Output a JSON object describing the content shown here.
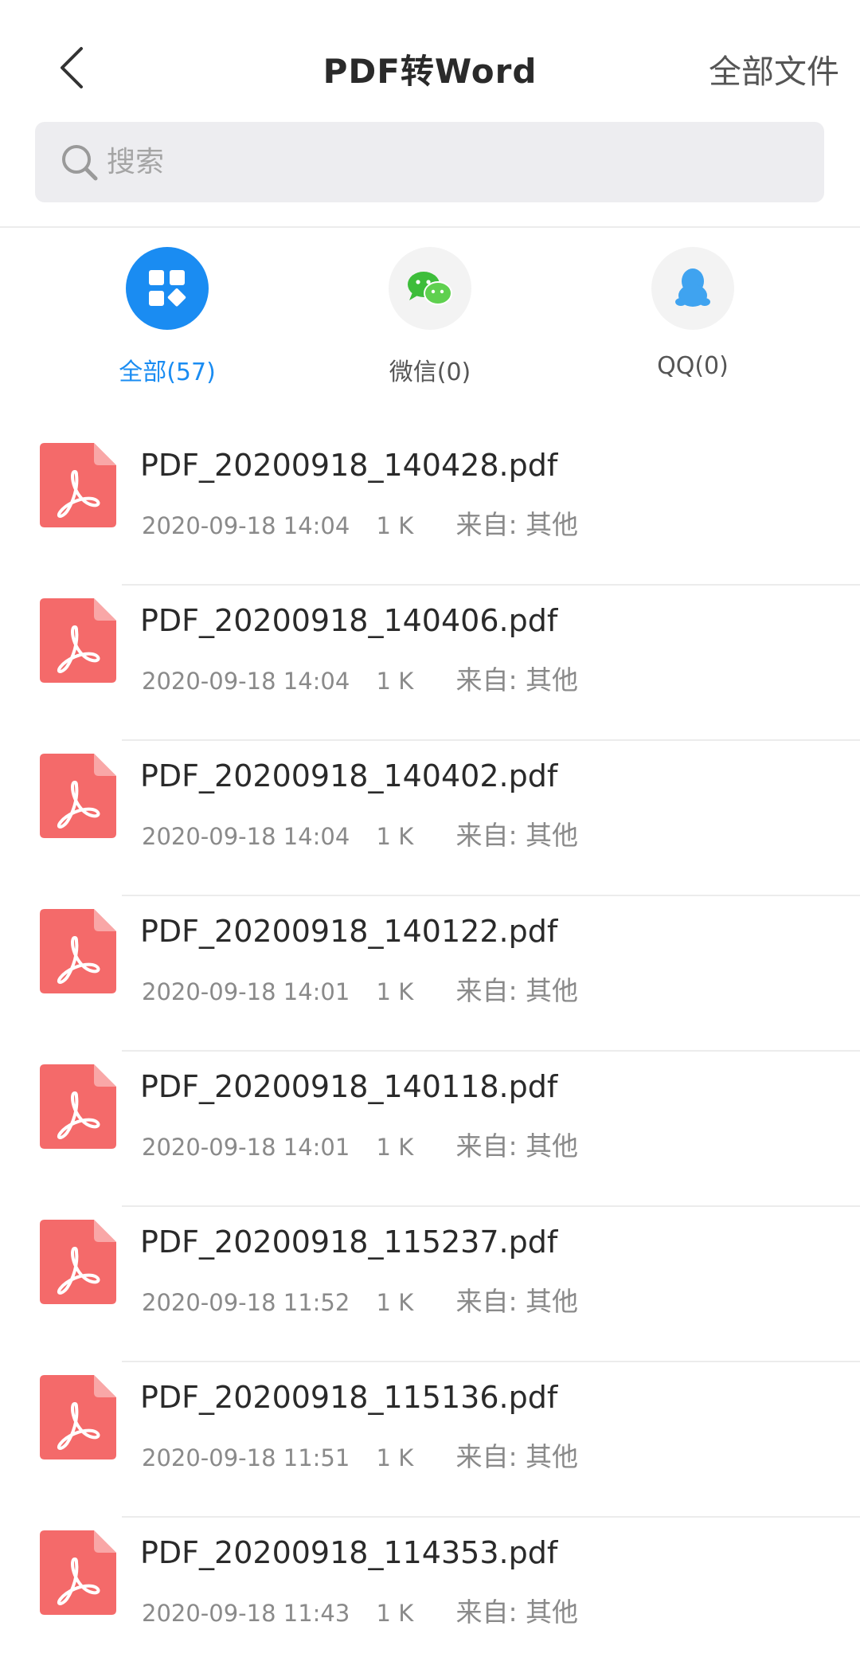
{
  "header": {
    "title": "PDF转Word",
    "right_link": "全部文件"
  },
  "search": {
    "placeholder": "搜索"
  },
  "categories": [
    {
      "label": "全部(57)",
      "icon": "grid-apps-icon",
      "active": true
    },
    {
      "label": "微信(0)",
      "icon": "wechat-icon",
      "active": false
    },
    {
      "label": "QQ(0)",
      "icon": "qq-penguin-icon",
      "active": false
    }
  ],
  "files": [
    {
      "name": "PDF_20200918_140428.pdf",
      "date": "2020-09-18 14:04",
      "size": "1 K",
      "source": "来自: 其他"
    },
    {
      "name": "PDF_20200918_140406.pdf",
      "date": "2020-09-18 14:04",
      "size": "1 K",
      "source": "来自: 其他"
    },
    {
      "name": "PDF_20200918_140402.pdf",
      "date": "2020-09-18 14:04",
      "size": "1 K",
      "source": "来自: 其他"
    },
    {
      "name": "PDF_20200918_140122.pdf",
      "date": "2020-09-18 14:01",
      "size": "1 K",
      "source": "来自: 其他"
    },
    {
      "name": "PDF_20200918_140118.pdf",
      "date": "2020-09-18 14:01",
      "size": "1 K",
      "source": "来自: 其他"
    },
    {
      "name": "PDF_20200918_115237.pdf",
      "date": "2020-09-18 11:52",
      "size": "1 K",
      "source": "来自: 其他"
    },
    {
      "name": "PDF_20200918_115136.pdf",
      "date": "2020-09-18 11:51",
      "size": "1 K",
      "source": "来自: 其他"
    },
    {
      "name": "PDF_20200918_114353.pdf",
      "date": "2020-09-18 11:43",
      "size": "1 K",
      "source": "来自: 其他"
    }
  ],
  "colors": {
    "accent": "#1a8cf2",
    "pdf_red": "#f46a6a",
    "wechat_green": "#3dbd3a",
    "qq_blue": "#3fa3f0"
  }
}
